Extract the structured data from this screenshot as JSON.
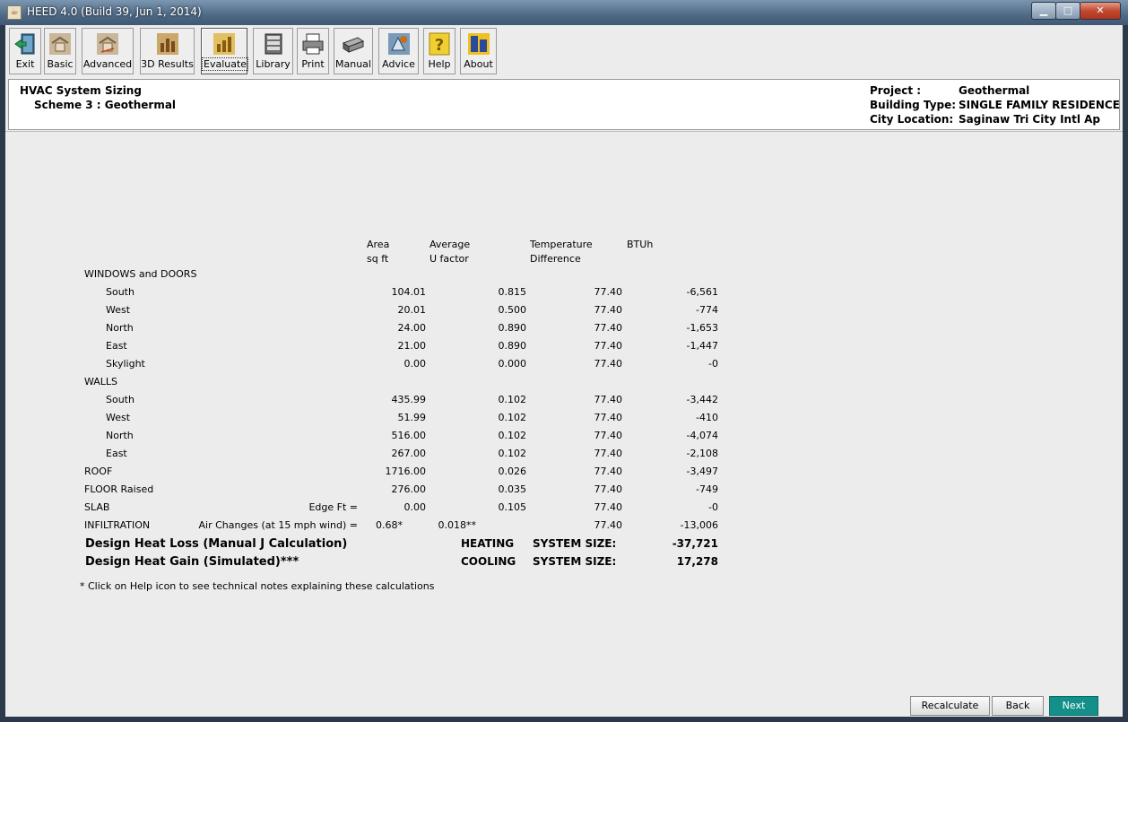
{
  "window": {
    "title": "HEED 4.0 (Build 39, Jun 1, 2014)",
    "title_icon": "java-cup-icon",
    "controls": {
      "minimize": "▁",
      "maximize": "□",
      "close": "✕"
    }
  },
  "toolbar": {
    "items": [
      {
        "label": "Exit",
        "icon": "exit-door-icon"
      },
      {
        "label": "Basic",
        "icon": "house-basic-icon"
      },
      {
        "label": "Advanced",
        "icon": "house-advanced-icon"
      },
      {
        "label": "3D Results",
        "icon": "bar-chart-3d-icon"
      },
      {
        "label": "Evaluate",
        "icon": "bar-chart-evaluate-icon"
      },
      {
        "label": "Library",
        "icon": "books-icon"
      },
      {
        "label": "Print",
        "icon": "printer-icon"
      },
      {
        "label": "Manual",
        "icon": "book-icon"
      },
      {
        "label": "Advice",
        "icon": "advice-icon"
      },
      {
        "label": "Help",
        "icon": "question-icon"
      },
      {
        "label": "About",
        "icon": "ucla-logo-icon"
      }
    ],
    "selected": "Evaluate"
  },
  "header": {
    "title": "HVAC System Sizing",
    "scheme": "Scheme 3 : Geothermal",
    "project_label": "Project :",
    "project_value": "Geothermal",
    "building_label": "Building Type:",
    "building_value": "SINGLE FAMILY RESIDENCE",
    "city_label": "City Location:",
    "city_value": "Saginaw Tri City Intl Ap"
  },
  "columns": {
    "area_1": "Area",
    "area_2": "sq ft",
    "u_1": "Average",
    "u_2": "U factor",
    "td_1": "Temperature",
    "td_2": "Difference",
    "btuh": "BTUh"
  },
  "sections": {
    "windows": "WINDOWS and DOORS",
    "walls": "WALLS"
  },
  "rows": [
    {
      "label": "South",
      "area": "104.01",
      "u": "0.815",
      "td": "77.40",
      "btuh": "-6,561"
    },
    {
      "label": "West",
      "area": "20.01",
      "u": "0.500",
      "td": "77.40",
      "btuh": "-774"
    },
    {
      "label": "North",
      "area": "24.00",
      "u": "0.890",
      "td": "77.40",
      "btuh": "-1,653"
    },
    {
      "label": "East",
      "area": "21.00",
      "u": "0.890",
      "td": "77.40",
      "btuh": "-1,447"
    },
    {
      "label": "Skylight",
      "area": "0.00",
      "u": "0.000",
      "td": "77.40",
      "btuh": "-0"
    },
    {
      "label": "South",
      "area": "435.99",
      "u": "0.102",
      "td": "77.40",
      "btuh": "-3,442"
    },
    {
      "label": "West",
      "area": "51.99",
      "u": "0.102",
      "td": "77.40",
      "btuh": "-410"
    },
    {
      "label": "North",
      "area": "516.00",
      "u": "0.102",
      "td": "77.40",
      "btuh": "-4,074"
    },
    {
      "label": "East",
      "area": "267.00",
      "u": "0.102",
      "td": "77.40",
      "btuh": "-2,108"
    },
    {
      "label": "ROOF",
      "area": "1716.00",
      "u": "0.026",
      "td": "77.40",
      "btuh": "-3,497"
    },
    {
      "label": "FLOOR Raised",
      "area": "276.00",
      "u": "0.035",
      "td": "77.40",
      "btuh": "-749"
    },
    {
      "label": "SLAB",
      "extra": "Edge Ft =",
      "area": "0.00",
      "u": "0.105",
      "td": "77.40",
      "btuh": "-0"
    },
    {
      "label": "INFILTRATION",
      "extra": "Air Changes (at 15 mph wind) =",
      "area": "0.68*",
      "u": "0.018**",
      "td": "77.40",
      "btuh": "-13,006"
    }
  ],
  "totals": {
    "heat_loss_label": "Design Heat Loss (Manual J Calculation)",
    "heating": "HEATING",
    "heating_size_label": "SYSTEM SIZE:",
    "heating_size": "-37,721",
    "heat_gain_label": "Design Heat Gain (Simulated)***",
    "cooling": "COOLING",
    "cooling_size_label": "SYSTEM SIZE:",
    "cooling_size": "17,278"
  },
  "footnote": "* Click on Help icon to see technical notes explaining these calculations",
  "buttons": {
    "recalculate": "Recalculate",
    "back": "Back",
    "next": "Next"
  },
  "colors": {
    "next_button": "#14908a",
    "titlebar": "#4e6a86"
  }
}
